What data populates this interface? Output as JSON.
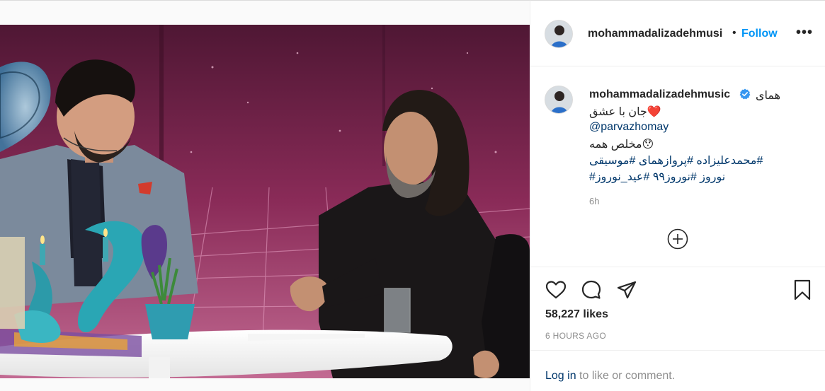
{
  "post": {
    "username": "mohammadalizadehmusic",
    "username_header": "mohammadalizadehmusi",
    "dot": "•",
    "follow_label": "Follow",
    "more_label": "•••",
    "caption": {
      "first": "همای",
      "line2": "جان با عشق❤️",
      "line3": "@parvazhomay",
      "line4": "مخلص همه😯",
      "line5": "محمدعلیزاده #پروازهمای #موسیقی#",
      "line6": "#نوروز #نوروز۹۹ #عید_نوروز"
    },
    "time_ago": "6h",
    "likes": "58,227 likes",
    "time_upper": "6 HOURS AGO",
    "login_link": "Log in",
    "login_rest": " to like or comment."
  },
  "icons": {
    "verified": "verified-badge-icon",
    "load_more": "plus-circle-icon",
    "like": "heart-icon",
    "comment": "comment-icon",
    "share": "paper-plane-icon",
    "save": "bookmark-icon"
  },
  "colors": {
    "link": "#00376b",
    "follow": "#0095f6",
    "verified": "#3897f0",
    "muted": "#8e8e8e"
  }
}
